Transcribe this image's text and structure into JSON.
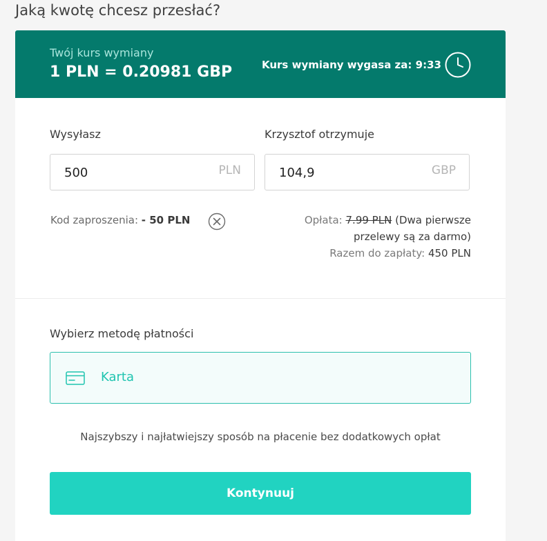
{
  "page": {
    "title": "Jaką kwotę chcesz przesłać?"
  },
  "rate": {
    "label": "Twój kurs wymiany",
    "value": "1 PLN = 0.20981 GBP",
    "expiry": "Kurs wymiany wygasa za: 9:33",
    "icon": "clock-icon"
  },
  "send": {
    "label": "Wysyłasz",
    "amount": "500",
    "currency": "PLN"
  },
  "receive": {
    "label": "Krzysztof otrzymuje",
    "amount": "104,9",
    "currency": "GBP"
  },
  "promo": {
    "label": "Kod zaproszenia:",
    "value": "- 50 PLN",
    "icon": "close-circle-icon"
  },
  "fee": {
    "label": "Opłata:",
    "old_fee": "7.99 PLN",
    "note_line1": "(Dwa pierwsze",
    "note_line2": "przelewy są za darmo)",
    "total_label": "Razem do zapłaty:",
    "total_value": "450 PLN"
  },
  "payment": {
    "label": "Wybierz metodę płatności",
    "selected_method": "Karta",
    "method_icon": "credit-card-icon",
    "note": "Najszybszy i najłatwiejszy sposób na płacenie bez dodatkowych opłat"
  },
  "actions": {
    "continue_label": "Kontynuuj"
  },
  "colors": {
    "banner": "#047a6c",
    "accent": "#21d3c1",
    "selected_border": "#2bbfad"
  }
}
